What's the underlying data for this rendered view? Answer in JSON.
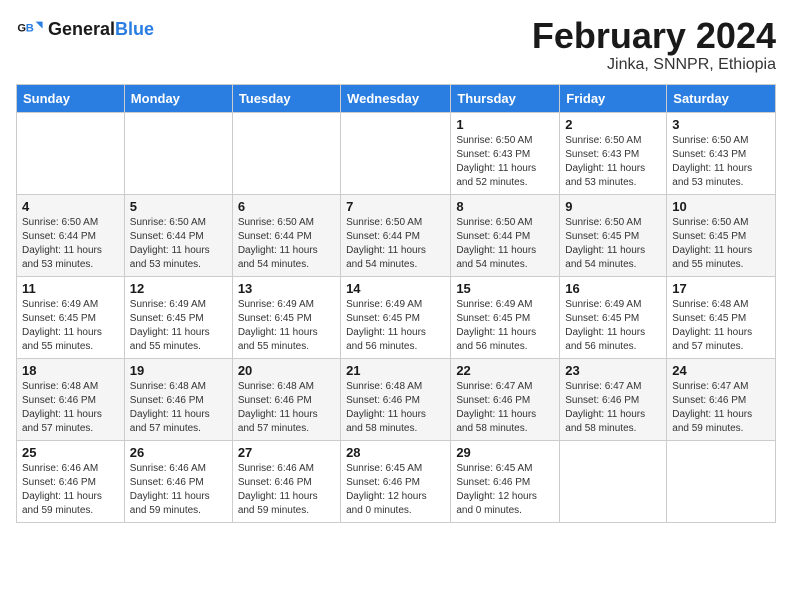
{
  "header": {
    "logo_general": "General",
    "logo_blue": "Blue",
    "main_title": "February 2024",
    "subtitle": "Jinka, SNNPR, Ethiopia"
  },
  "days_of_week": [
    "Sunday",
    "Monday",
    "Tuesday",
    "Wednesday",
    "Thursday",
    "Friday",
    "Saturday"
  ],
  "weeks": [
    [
      {
        "day": "",
        "info": ""
      },
      {
        "day": "",
        "info": ""
      },
      {
        "day": "",
        "info": ""
      },
      {
        "day": "",
        "info": ""
      },
      {
        "day": "1",
        "info": "Sunrise: 6:50 AM\nSunset: 6:43 PM\nDaylight: 11 hours\nand 52 minutes."
      },
      {
        "day": "2",
        "info": "Sunrise: 6:50 AM\nSunset: 6:43 PM\nDaylight: 11 hours\nand 53 minutes."
      },
      {
        "day": "3",
        "info": "Sunrise: 6:50 AM\nSunset: 6:43 PM\nDaylight: 11 hours\nand 53 minutes."
      }
    ],
    [
      {
        "day": "4",
        "info": "Sunrise: 6:50 AM\nSunset: 6:44 PM\nDaylight: 11 hours\nand 53 minutes."
      },
      {
        "day": "5",
        "info": "Sunrise: 6:50 AM\nSunset: 6:44 PM\nDaylight: 11 hours\nand 53 minutes."
      },
      {
        "day": "6",
        "info": "Sunrise: 6:50 AM\nSunset: 6:44 PM\nDaylight: 11 hours\nand 54 minutes."
      },
      {
        "day": "7",
        "info": "Sunrise: 6:50 AM\nSunset: 6:44 PM\nDaylight: 11 hours\nand 54 minutes."
      },
      {
        "day": "8",
        "info": "Sunrise: 6:50 AM\nSunset: 6:44 PM\nDaylight: 11 hours\nand 54 minutes."
      },
      {
        "day": "9",
        "info": "Sunrise: 6:50 AM\nSunset: 6:45 PM\nDaylight: 11 hours\nand 54 minutes."
      },
      {
        "day": "10",
        "info": "Sunrise: 6:50 AM\nSunset: 6:45 PM\nDaylight: 11 hours\nand 55 minutes."
      }
    ],
    [
      {
        "day": "11",
        "info": "Sunrise: 6:49 AM\nSunset: 6:45 PM\nDaylight: 11 hours\nand 55 minutes."
      },
      {
        "day": "12",
        "info": "Sunrise: 6:49 AM\nSunset: 6:45 PM\nDaylight: 11 hours\nand 55 minutes."
      },
      {
        "day": "13",
        "info": "Sunrise: 6:49 AM\nSunset: 6:45 PM\nDaylight: 11 hours\nand 55 minutes."
      },
      {
        "day": "14",
        "info": "Sunrise: 6:49 AM\nSunset: 6:45 PM\nDaylight: 11 hours\nand 56 minutes."
      },
      {
        "day": "15",
        "info": "Sunrise: 6:49 AM\nSunset: 6:45 PM\nDaylight: 11 hours\nand 56 minutes."
      },
      {
        "day": "16",
        "info": "Sunrise: 6:49 AM\nSunset: 6:45 PM\nDaylight: 11 hours\nand 56 minutes."
      },
      {
        "day": "17",
        "info": "Sunrise: 6:48 AM\nSunset: 6:45 PM\nDaylight: 11 hours\nand 57 minutes."
      }
    ],
    [
      {
        "day": "18",
        "info": "Sunrise: 6:48 AM\nSunset: 6:46 PM\nDaylight: 11 hours\nand 57 minutes."
      },
      {
        "day": "19",
        "info": "Sunrise: 6:48 AM\nSunset: 6:46 PM\nDaylight: 11 hours\nand 57 minutes."
      },
      {
        "day": "20",
        "info": "Sunrise: 6:48 AM\nSunset: 6:46 PM\nDaylight: 11 hours\nand 57 minutes."
      },
      {
        "day": "21",
        "info": "Sunrise: 6:48 AM\nSunset: 6:46 PM\nDaylight: 11 hours\nand 58 minutes."
      },
      {
        "day": "22",
        "info": "Sunrise: 6:47 AM\nSunset: 6:46 PM\nDaylight: 11 hours\nand 58 minutes."
      },
      {
        "day": "23",
        "info": "Sunrise: 6:47 AM\nSunset: 6:46 PM\nDaylight: 11 hours\nand 58 minutes."
      },
      {
        "day": "24",
        "info": "Sunrise: 6:47 AM\nSunset: 6:46 PM\nDaylight: 11 hours\nand 59 minutes."
      }
    ],
    [
      {
        "day": "25",
        "info": "Sunrise: 6:46 AM\nSunset: 6:46 PM\nDaylight: 11 hours\nand 59 minutes."
      },
      {
        "day": "26",
        "info": "Sunrise: 6:46 AM\nSunset: 6:46 PM\nDaylight: 11 hours\nand 59 minutes."
      },
      {
        "day": "27",
        "info": "Sunrise: 6:46 AM\nSunset: 6:46 PM\nDaylight: 11 hours\nand 59 minutes."
      },
      {
        "day": "28",
        "info": "Sunrise: 6:45 AM\nSunset: 6:46 PM\nDaylight: 12 hours\nand 0 minutes."
      },
      {
        "day": "29",
        "info": "Sunrise: 6:45 AM\nSunset: 6:46 PM\nDaylight: 12 hours\nand 0 minutes."
      },
      {
        "day": "",
        "info": ""
      },
      {
        "day": "",
        "info": ""
      }
    ]
  ]
}
